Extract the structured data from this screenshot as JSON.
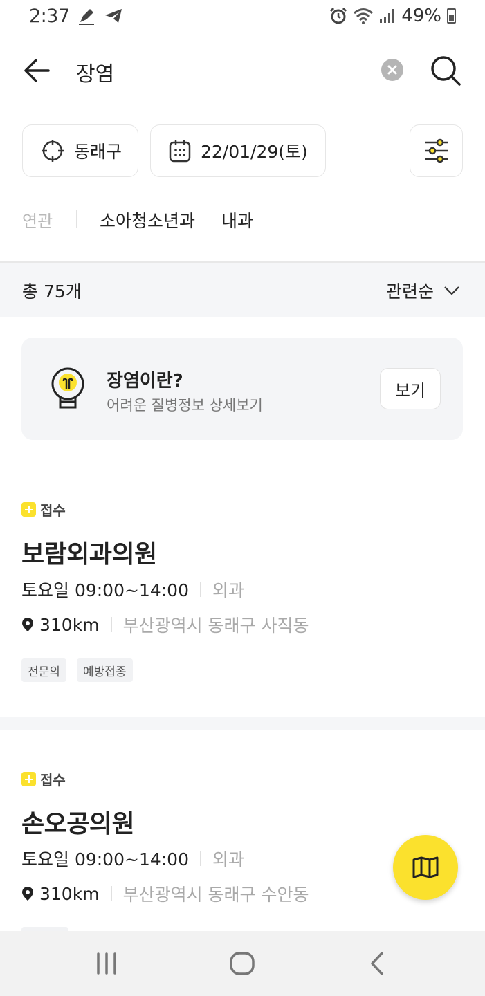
{
  "status_bar": {
    "time": "2:37",
    "battery": "49%",
    "icons": [
      "pen-icon",
      "telegram-icon",
      "alarm-icon",
      "wifi-icon",
      "signal-icon",
      "battery-icon"
    ]
  },
  "search": {
    "query": "장염"
  },
  "filters": {
    "location": "동래구",
    "date": "22/01/29(토)"
  },
  "related": {
    "label": "연관",
    "tags": [
      "소아청소년과",
      "내과"
    ]
  },
  "results": {
    "count_text": "총 75개",
    "sort_label": "관련순"
  },
  "info_card": {
    "title": "장염이란?",
    "subtitle": "어려운 질병정보 상세보기",
    "button_label": "보기"
  },
  "hospitals": [
    {
      "badge": "접수",
      "name": "보람외과의원",
      "hours": "토요일 09:00~14:00",
      "department": "외과",
      "distance": "310km",
      "address": "부산광역시 동래구 사직동",
      "tags": [
        "전문의",
        "예방접종"
      ]
    },
    {
      "badge": "접수",
      "name": "손오공의원",
      "hours": "토요일 09:00~14:00",
      "department": "외과",
      "distance": "310km",
      "address": "부산광역시 동래구 수안동",
      "tags": []
    }
  ],
  "colors": {
    "accent": "#fbe12d",
    "muted_text": "#a9a9a9",
    "section_bg": "#f5f6f8"
  }
}
